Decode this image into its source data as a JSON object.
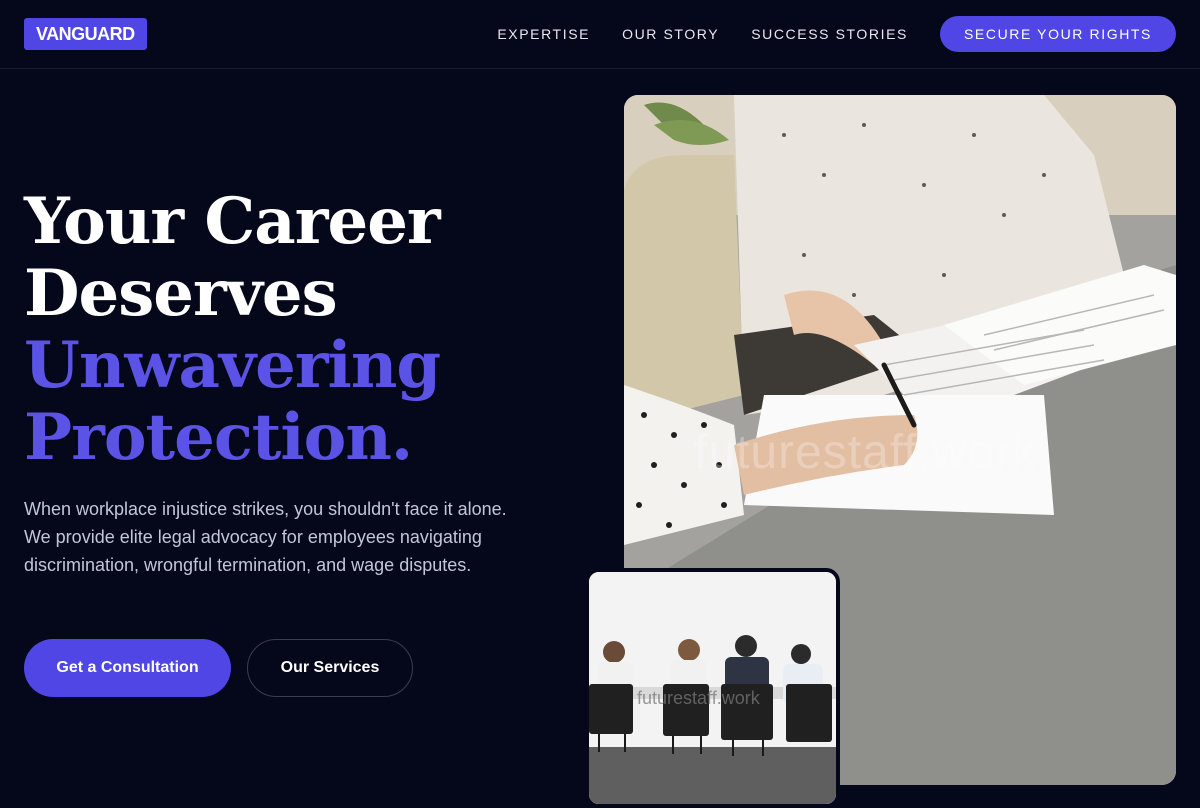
{
  "header": {
    "logo": "VANGUARD",
    "nav": {
      "expertise": "EXPERTISE",
      "our_story": "OUR STORY",
      "success_stories": "SUCCESS STORIES"
    },
    "cta": "SECURE YOUR RIGHTS"
  },
  "hero": {
    "title_line1": "Your Career",
    "title_line2": "Deserves",
    "title_accent_line1": "Unwavering",
    "title_accent_line2": "Protection.",
    "description": "When workplace injustice strikes, you shouldn't face it alone. We provide elite legal advocacy for employees navigating discrimination, wrongful termination, and wage disputes.",
    "primary_button": "Get a Consultation",
    "secondary_button": "Our Services"
  },
  "images": {
    "main_watermark": "futurestaff.work",
    "secondary_watermark": "futurestaff.work"
  },
  "colors": {
    "background": "#05071a",
    "accent": "#4f46e5",
    "accent_text": "#5b52e6",
    "body_text": "#c3c6d8"
  },
  "icons": {
    "main_image": "office-document-signing-photo",
    "secondary_image": "meeting-room-photo"
  }
}
